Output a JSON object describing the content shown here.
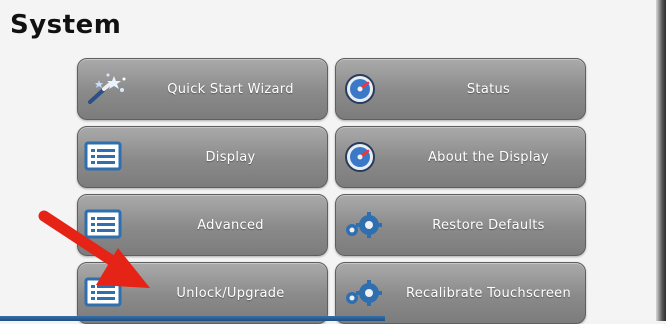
{
  "page": {
    "title": "System"
  },
  "buttons": {
    "quick_start_wizard": "Quick Start Wizard",
    "status": "Status",
    "display": "Display",
    "about_display": "About the Display",
    "advanced": "Advanced",
    "restore_defaults": "Restore Defaults",
    "unlock_upgrade": "Unlock/Upgrade",
    "recalibrate_touchscreen": "Recalibrate Touchscreen"
  },
  "icons": {
    "quick_start_wizard": "magic-wand-icon",
    "status": "gauge-icon",
    "display": "list-icon",
    "about_display": "gauge-icon",
    "advanced": "list-icon",
    "restore_defaults": "gears-icon",
    "unlock_upgrade": "list-icon",
    "recalibrate_touchscreen": "gears-icon"
  },
  "colors": {
    "button_gradient_top": "#aaaaaa",
    "button_gradient_bottom": "#7c7c7c",
    "arrow": "#e52317",
    "icon_blue": "#2f6fb0"
  }
}
